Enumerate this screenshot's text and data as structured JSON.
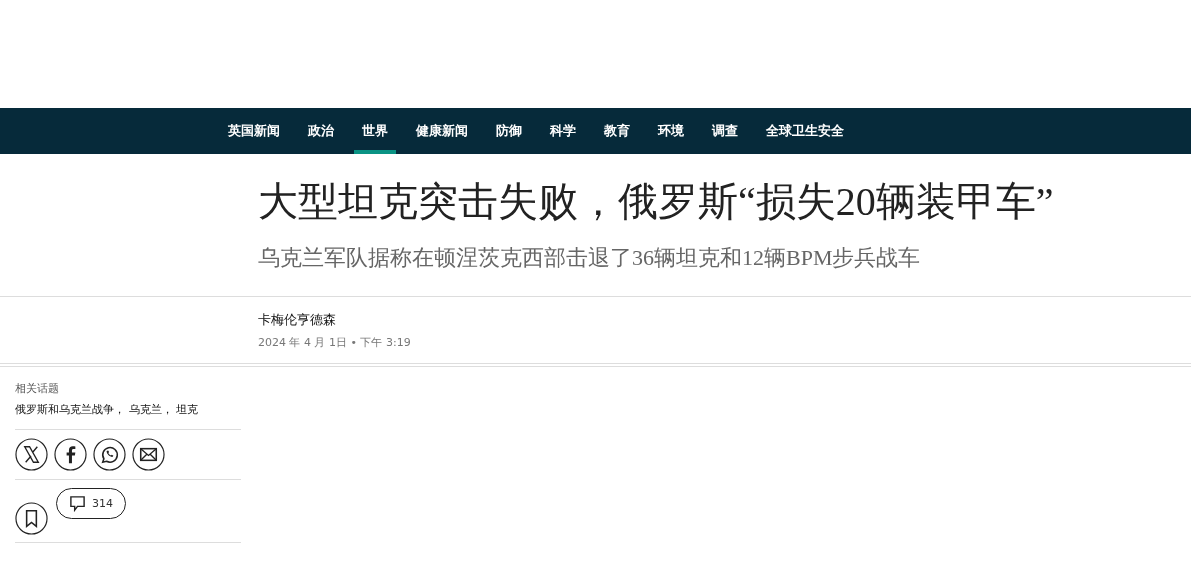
{
  "nav": [
    {
      "label": "英国新闻",
      "selected": false
    },
    {
      "label": "政治",
      "selected": false
    },
    {
      "label": "世界",
      "selected": true
    },
    {
      "label": "健康新闻",
      "selected": false
    },
    {
      "label": "防御",
      "selected": false
    },
    {
      "label": "科学",
      "selected": false
    },
    {
      "label": "教育",
      "selected": false
    },
    {
      "label": "环境",
      "selected": false
    },
    {
      "label": "调查",
      "selected": false
    },
    {
      "label": "全球卫生安全",
      "selected": false
    }
  ],
  "headline": "大型坦克突击失败，俄罗斯“损失20辆装甲车”",
  "standfirst": "乌克兰军队据称在顿涅茨克西部击退了36辆坦克和12辆BPM步兵战车",
  "byline": {
    "author": "卡梅伦亨德森",
    "date": "2024 年 4 月 1日 • 下午 3:19"
  },
  "sidebar": {
    "heading": "相关话题",
    "topics": [
      "俄罗斯和乌克兰战争",
      "乌克兰",
      "坦克"
    ],
    "separator": "， ",
    "share": [
      {
        "kind": "x"
      },
      {
        "kind": "facebook"
      },
      {
        "kind": "whatsapp"
      },
      {
        "kind": "email"
      }
    ],
    "comments": "314"
  }
}
